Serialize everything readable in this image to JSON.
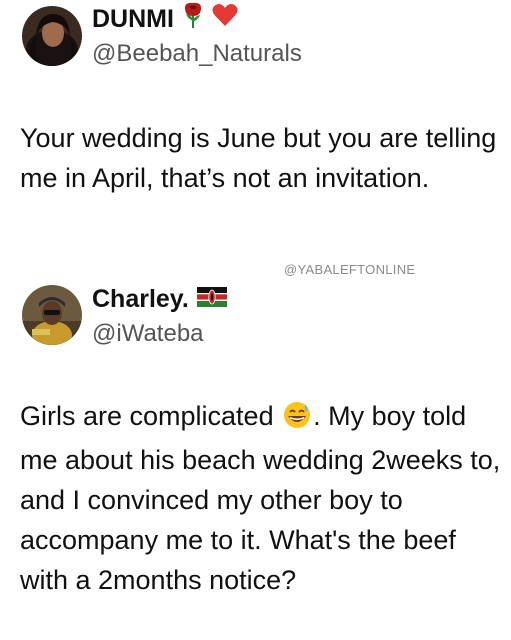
{
  "tweets": [
    {
      "author": {
        "display_name": "DUNMI",
        "name_emojis": [
          "rose-icon",
          "red-heart-icon"
        ],
        "handle": "@Beebah_Naturals"
      },
      "text": "Your wedding is June but you are telling me in April, that’s not an invitation."
    },
    {
      "author": {
        "display_name": "Charley.",
        "name_emojis": [
          "kenya-flag-icon"
        ],
        "handle": "@iWateba"
      },
      "text_before_emoji": "Girls are complicated",
      "inline_emoji": "grinning-sweat-face-icon",
      "text_after_emoji": ". My boy told me about his beach wedding 2weeks to, and I convinced my other boy to accompany me to it. What's the beef with a 2months notice?"
    }
  ],
  "watermark": "@YABALEFTONLINE",
  "colors": {
    "text": "#111111",
    "handle": "#555555",
    "watermark": "#8a8a8a",
    "background": "#ffffff"
  }
}
